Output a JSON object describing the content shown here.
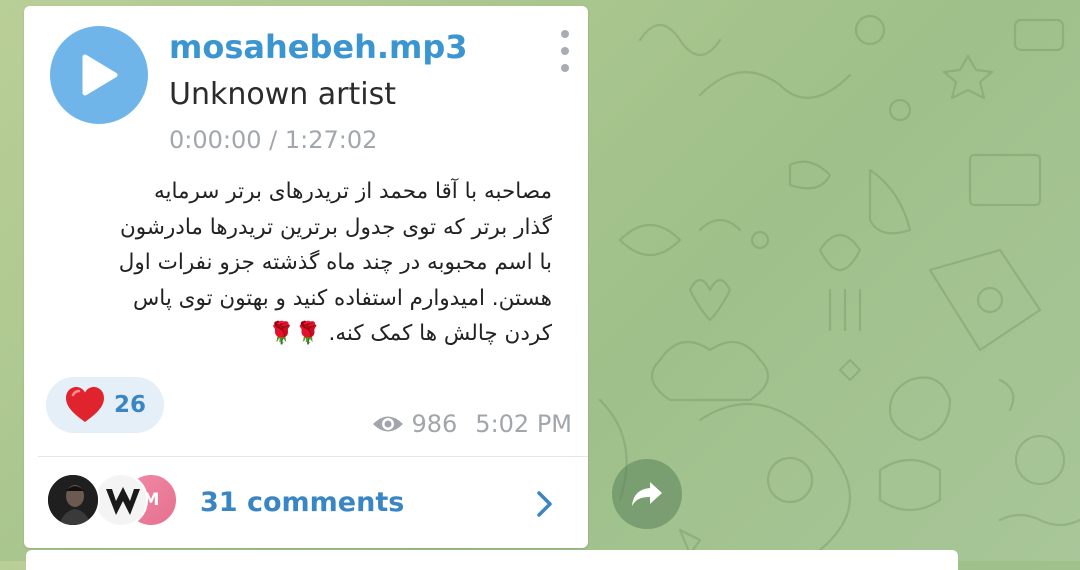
{
  "post": {
    "file_name": "mosahebeh.mp3",
    "artist": "Unknown artist",
    "duration": "0:00:00 / 1:27:02",
    "caption_lines": [
      "مصاحبه با آقا محمد از تریدرهای برتر سرمایه",
      "گذار برتر که توی جدول برترین تریدرها مادرشون",
      "با اسم محبوبه در چند ماه گذشته جزو نفرات اول",
      "هستن. امیدوارم استفاده کنید و بهتون توی پاس",
      "کردن چالش ها کمک کنه."
    ],
    "caption_emoji": "🌹🌹",
    "reaction": {
      "emoji_icon": "heart-icon",
      "count": "26"
    },
    "views": "986",
    "time": "5:02 PM",
    "comments": {
      "label": "31 comments",
      "avatar_initial": "M"
    }
  },
  "colors": {
    "accent": "#3a95d0",
    "play_button": "#6fb5ea",
    "reaction_bg": "#e5eff8",
    "meta_text": "#a0a6ac",
    "heart": "#e0242e",
    "rose": "#c8102e"
  }
}
